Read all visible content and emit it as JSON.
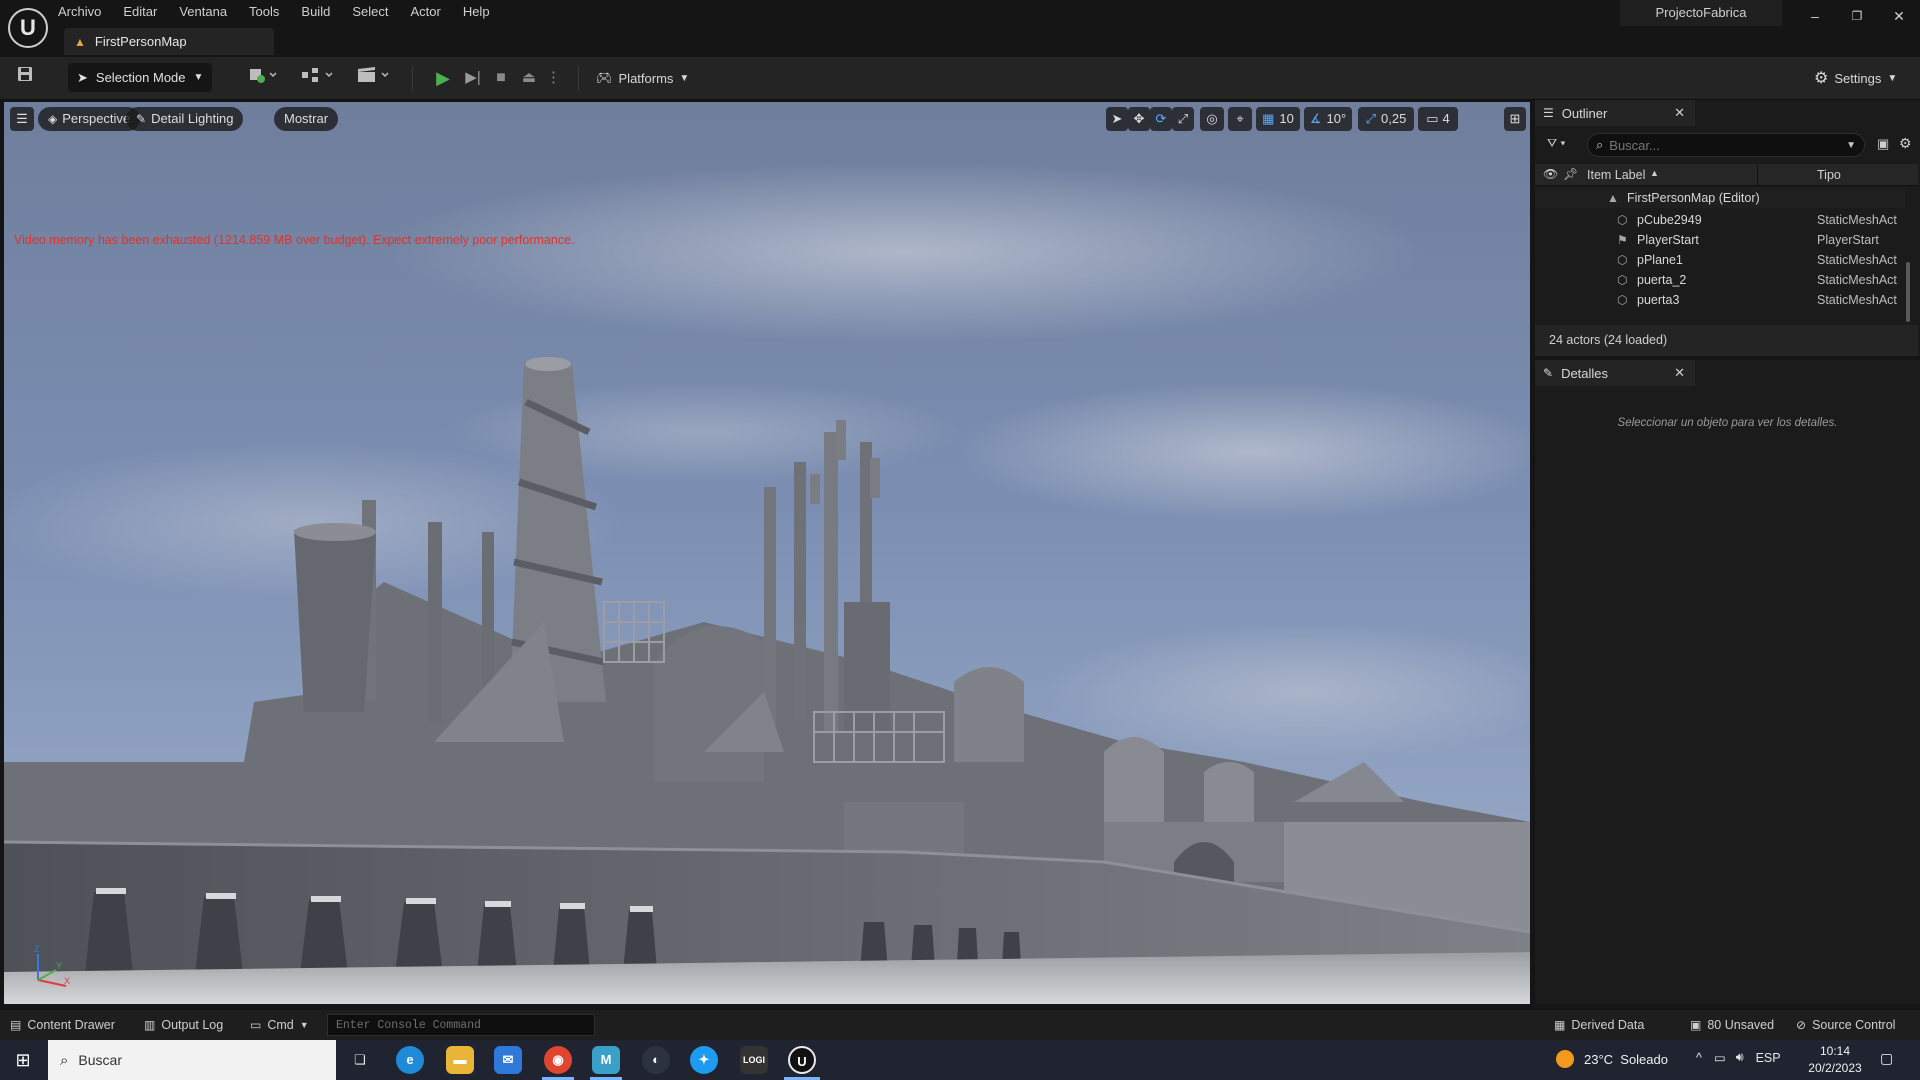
{
  "menu": [
    "Archivo",
    "Editar",
    "Ventana",
    "Tools",
    "Build",
    "Select",
    "Actor",
    "Help"
  ],
  "document_tab": "FirstPersonMap",
  "project_name": "ProjectoFabrica",
  "toolbar": {
    "selection_mode": "Selection Mode",
    "platforms": "Platforms",
    "settings": "Settings"
  },
  "viewport": {
    "perspective": "Perspective",
    "lighting": "Detail Lighting",
    "show": "Mostrar",
    "grid_snap": "10",
    "rotation_snap": "10°",
    "scale_snap": "0,25",
    "camera_speed": "4",
    "warning": "Video memory has been exhausted (1214.859 MB over budget). Expect extremely poor performance."
  },
  "outliner": {
    "title": "Outliner",
    "search_placeholder": "Buscar...",
    "col_label": "Item Label",
    "col_type": "Tipo",
    "root": "FirstPersonMap (Editor)",
    "rows": [
      {
        "name": "pCube2949",
        "type": "StaticMeshAct"
      },
      {
        "name": "PlayerStart",
        "type": "PlayerStart"
      },
      {
        "name": "pPlane1",
        "type": "StaticMeshAct"
      },
      {
        "name": "puerta_2",
        "type": "StaticMeshAct"
      },
      {
        "name": "puerta3",
        "type": "StaticMeshAct"
      }
    ],
    "footer": "24 actors (24 loaded)"
  },
  "details": {
    "title": "Detalles",
    "empty": "Seleccionar un objeto para ver los detalles."
  },
  "statusbar": {
    "content_drawer": "Content Drawer",
    "output_log": "Output Log",
    "cmd": "Cmd",
    "console_placeholder": "Enter Console Command",
    "derived_data": "Derived Data",
    "unsaved": "80 Unsaved",
    "source_control": "Source Control"
  },
  "taskbar": {
    "search": "Buscar",
    "weather": "23°C  Soleado",
    "lang": "ESP",
    "time": "10:14",
    "date": "20/2/2023"
  },
  "colors": {
    "accent_play": "#4caf50",
    "accent_blue": "#3a8dde",
    "warning_red": "#e0332b",
    "map_icon": "#e8a33c"
  }
}
